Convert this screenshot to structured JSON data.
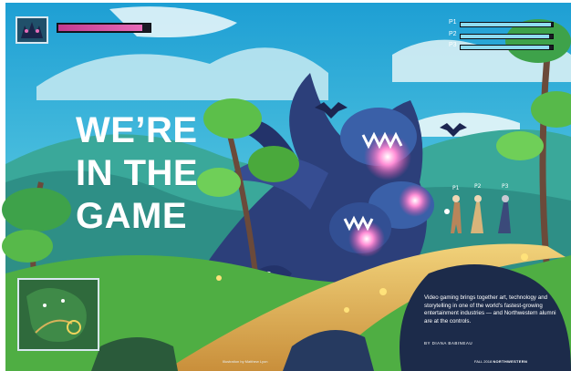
{
  "headline": {
    "lines": [
      "WE’RE",
      "IN THE",
      "GAME"
    ]
  },
  "hud": {
    "boss_health": 0.92,
    "players": [
      {
        "label": "P1",
        "health": 0.98
      },
      {
        "label": "P2",
        "health": 0.96
      },
      {
        "label": "P3",
        "health": 0.96
      }
    ],
    "colors": {
      "boss_bar": "#d04e9f",
      "player_bar": "#8fdcef",
      "bar_frame": "#1a1a24"
    }
  },
  "scene": {
    "character_markers": [
      "P1",
      "P2",
      "P3"
    ],
    "palette": {
      "sky": "#33b7dd",
      "dragon": "#2c3f7a",
      "dragon_belly": "#e44fa8",
      "grass": "#5cbf4a",
      "path": "#d7a74a",
      "rocks": "#1c2b4a"
    }
  },
  "deck": "Video gaming brings together art, technology and storytelling in one of the world's fastest-growing entertainment industries — and Northwestern alumni are at the controls.",
  "byline": "BY DIANA BABINEAU",
  "credit": "Illustration by Matthew Lyon",
  "folio": {
    "season": "FALL 2018",
    "publication": "NORTHWESTERN"
  }
}
